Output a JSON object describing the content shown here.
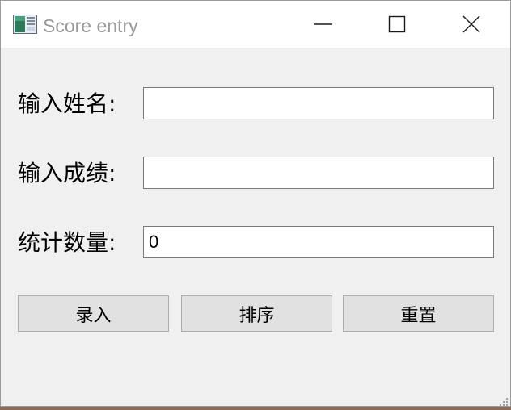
{
  "window": {
    "title": "Score entry",
    "controls": {
      "minimize": "minimize",
      "maximize": "maximize",
      "close": "close"
    }
  },
  "form": {
    "name_label": "输入姓名:",
    "name_value": "",
    "score_label": "输入成绩:",
    "score_value": "",
    "count_label": "统计数量:",
    "count_value": "0"
  },
  "buttons": {
    "enter_label": "录入",
    "sort_label": "排序",
    "reset_label": "重置"
  },
  "icons": {
    "app": "app-window-icon",
    "minimize": "minimize-icon",
    "maximize": "maximize-icon",
    "close": "close-icon",
    "resize": "resize-grip-icon"
  }
}
